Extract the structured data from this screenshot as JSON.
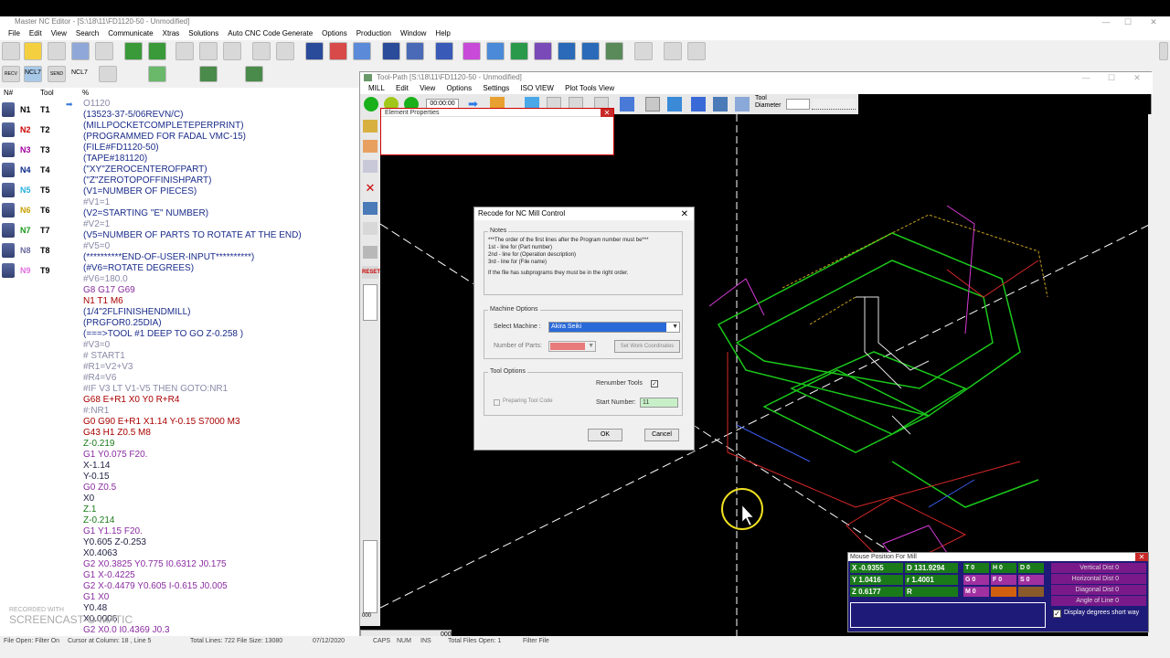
{
  "app": {
    "title": "Master NC Editor - [S:\\18\\11\\FD1120-50 - Unmodified]",
    "menu": [
      "File",
      "Edit",
      "View",
      "Search",
      "Communicate",
      "Xtras",
      "Solutions",
      "Auto CNC Code Generate",
      "Options",
      "Production",
      "Window",
      "Help"
    ],
    "toolbar2": [
      "RECV",
      "SEND",
      "NCL7",
      "NCL7"
    ]
  },
  "leftpane": {
    "col_n": "N#",
    "col_tool": "Tool",
    "col_pct": "%",
    "rows": [
      {
        "n": "N1",
        "t": "T1",
        "color": "#000"
      },
      {
        "n": "N2",
        "t": "T2",
        "color": "#c00"
      },
      {
        "n": "N3",
        "t": "T3",
        "color": "#a000a0"
      },
      {
        "n": "N4",
        "t": "T4",
        "color": "#0a2a8a"
      },
      {
        "n": "N5",
        "t": "T5",
        "color": "#2ab0e0"
      },
      {
        "n": "N6",
        "t": "T6",
        "color": "#c8a000"
      },
      {
        "n": "N7",
        "t": "T7",
        "color": "#1a9a1a"
      },
      {
        "n": "N8",
        "t": "T8",
        "color": "#6a6aa0"
      },
      {
        "n": "N9",
        "t": "T9",
        "color": "#e070e0"
      }
    ],
    "code": [
      {
        "t": "O1120",
        "c": "c-gray"
      },
      {
        "t": "(13523-37-5/06REVN/C)",
        "c": "c-blue"
      },
      {
        "t": "(MILLPOCKETCOMPLETEPERPRINT)",
        "c": "c-blue"
      },
      {
        "t": "(PROGRAMMED FOR FADAL VMC-15)",
        "c": "c-blue"
      },
      {
        "t": "(FILE#FD1120-50)",
        "c": "c-blue"
      },
      {
        "t": "(TAPE#181120)",
        "c": "c-blue"
      },
      {
        "t": "(\"XY\"ZEROCENTEROFPART)",
        "c": "c-blue"
      },
      {
        "t": "(\"Z\"ZEROTOPOFFINISHPART)",
        "c": "c-blue"
      },
      {
        "t": "(V1=NUMBER OF PIECES)",
        "c": "c-blue"
      },
      {
        "t": "#V1=1",
        "c": "c-gray"
      },
      {
        "t": "(V2=STARTING \"E\" NUMBER)",
        "c": "c-blue"
      },
      {
        "t": "#V2=1",
        "c": "c-gray"
      },
      {
        "t": "(V5=NUMBER OF PARTS TO ROTATE AT THE END)",
        "c": "c-blue"
      },
      {
        "t": "#V5=0",
        "c": "c-gray"
      },
      {
        "t": "(**********END-OF-USER-INPUT**********)",
        "c": "c-blue"
      },
      {
        "t": "(#V6=ROTATE DEGREES)",
        "c": "c-blue"
      },
      {
        "t": "#V6=180.0",
        "c": "c-gray"
      },
      {
        "t": "G8 G17 G69",
        "c": "c-purple"
      },
      {
        "t": "N1 T1 M6",
        "c": "c-red"
      },
      {
        "t": "(1/4\"2FLFINISHENDMILL)",
        "c": "c-blue"
      },
      {
        "t": "(PRGFOR0.25DIA)",
        "c": "c-blue"
      },
      {
        "t": "(===>TOOL #1 DEEP TO GO Z-0.258 )",
        "c": "c-blue"
      },
      {
        "t": "#V3=0",
        "c": "c-gray"
      },
      {
        "t": "# START1",
        "c": "c-gray"
      },
      {
        "t": "#R1=V2+V3",
        "c": "c-gray"
      },
      {
        "t": "#R4=V6",
        "c": "c-gray"
      },
      {
        "t": "#IF V3 LT V1-V5 THEN GOTO:NR1",
        "c": "c-gray"
      },
      {
        "t": "G68 E+R1 X0 Y0 R+R4",
        "c": "c-red"
      },
      {
        "t": "#:NR1",
        "c": "c-gray"
      },
      {
        "t": "G0 G90 E+R1 X1.14 Y-0.15 S7000 M3",
        "c": "c-red"
      },
      {
        "t": "G43 H1 Z0.5 M8",
        "c": "c-red"
      },
      {
        "t": "Z-0.219",
        "c": "c-green"
      },
      {
        "t": "G1 Y0.075 F20.",
        "c": "c-purple"
      },
      {
        "t": "X-1.14",
        "c": "c-dblue"
      },
      {
        "t": "Y-0.15",
        "c": "c-dblue"
      },
      {
        "t": "G0 Z0.5",
        "c": "c-purple"
      },
      {
        "t": "X0",
        "c": "c-dblue"
      },
      {
        "t": "Z.1",
        "c": "c-green"
      },
      {
        "t": "Z-0.214",
        "c": "c-green"
      },
      {
        "t": "G1 Y1.15 F20.",
        "c": "c-purple"
      },
      {
        "t": "Y0.605 Z-0.253",
        "c": "c-dblue"
      },
      {
        "t": "X0.4063",
        "c": "c-dblue"
      },
      {
        "t": "G2 X0.3825 Y0.775 I0.6312 J0.175",
        "c": "c-purple"
      },
      {
        "t": "G1 X-0.4225",
        "c": "c-purple"
      },
      {
        "t": "G2 X-0.4479 Y0.605 I-0.615 J0.005",
        "c": "c-purple"
      },
      {
        "t": "G1 X0",
        "c": "c-purple"
      },
      {
        "t": "Y0.48",
        "c": "c-dblue"
      },
      {
        "t": "X0.0006",
        "c": "c-dblue"
      },
      {
        "t": "G2 X0.0 I0.4369 J0.3",
        "c": "c-purple"
      }
    ]
  },
  "toolpath": {
    "title": "Tool-Path  [S:\\18\\11\\FD1120-50 - Unmodified]",
    "menu": [
      "MILL",
      "Edit",
      "View",
      "Options",
      "Settings",
      "ISO VIEW",
      "Plot Tools View"
    ],
    "time": "00:00:00",
    "tool_label_1": "Tool",
    "tool_label_2": "Diameter",
    "element_props_title": "Element Properties",
    "reset_label": "RESET",
    "scroll_value": "000"
  },
  "dialog": {
    "title": "Recode for NC Mill Control",
    "notes_label": "Notes",
    "notes": [
      "***The order of the first lines after the Program number must be***",
      "1st - line for (Part number)",
      "2nd - line for (Operation description)",
      "3rd - line for (File name)",
      "",
      "If the file has subprograms they must be in the right order."
    ],
    "machine_options_label": "Machine Options",
    "select_machine_label": "Select Machine :",
    "select_machine_value": "Akira Seiki",
    "number_of_parts_label": "Number of Parts:",
    "set_work_coords": "Set Work Coordinates",
    "tool_options_label": "Tool Options",
    "renumber_tools_label": "Renumber Tools",
    "preparing_tool_code_label": "Preparing Tool Code",
    "start_number_label": "Start Number:",
    "start_number_value": "11",
    "ok": "OK",
    "cancel": "Cancel"
  },
  "mouse_position": {
    "title": "Mouse Position For Mill",
    "x": "X -0.9355",
    "y": "Y 1.0416",
    "z": "Z 0.6177",
    "d": "D 131.9294",
    "r": "r 1.4001",
    "rr": "R",
    "t": "T 0",
    "h": "H 0",
    "dd": "D 0",
    "g": "G 0",
    "f": "F 0",
    "s": "S 0",
    "m": "M 0",
    "vdist": "Vertical Dist 0",
    "hdist": "Horizontal Dist 0",
    "ddist": "Diagonal Dist 0",
    "angle": "Angle of Line 0",
    "short_way": "Display degrees short way"
  },
  "statusbar": {
    "a": "File Open: Filter On",
    "b": "Cursor at Column: 18 , Line 5",
    "c": "Total Lines: 722   File Size: 13080",
    "d": "07/12/2020",
    "e": "CAPS",
    "f": "NUM",
    "g": "INS",
    "h": "Total Files Open: 1",
    "i": "Filter File"
  },
  "watermark": {
    "line1": "RECORDED WITH",
    "line2": "SCREENCAST-O-MATIC"
  }
}
